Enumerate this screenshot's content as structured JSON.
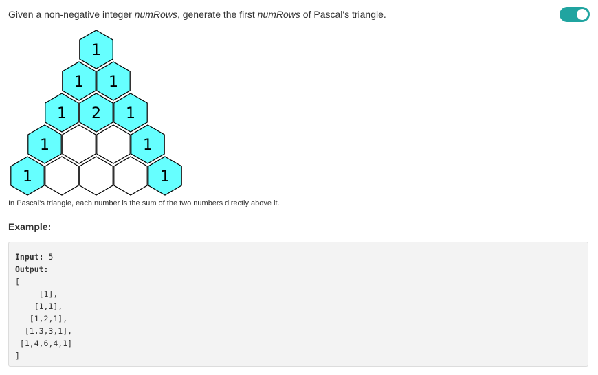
{
  "description": {
    "prefix": "Given a non-negative integer ",
    "var1": "numRows",
    "middle": ", generate the first ",
    "var2": "numRows",
    "suffix": " of Pascal's triangle."
  },
  "toggle": {
    "state": "on",
    "color": "#20a4a0"
  },
  "triangle": {
    "filled_color": "#66ffff",
    "empty_color": "#ffffff",
    "rows": [
      [
        "1"
      ],
      [
        "1",
        "1"
      ],
      [
        "1",
        "2",
        "1"
      ],
      [
        "1",
        "",
        "",
        "1"
      ],
      [
        "1",
        "",
        "",
        "",
        "1"
      ]
    ]
  },
  "caption": "In Pascal's triangle, each number is the sum of the two numbers directly above it.",
  "example": {
    "heading": "Example:",
    "input_label": "Input:",
    "input_value": " 5",
    "output_label": "Output:",
    "output_lines": [
      "[",
      "     [1],",
      "    [1,1],",
      "   [1,2,1],",
      "  [1,3,3,1],",
      " [1,4,6,4,1]",
      "]"
    ]
  }
}
